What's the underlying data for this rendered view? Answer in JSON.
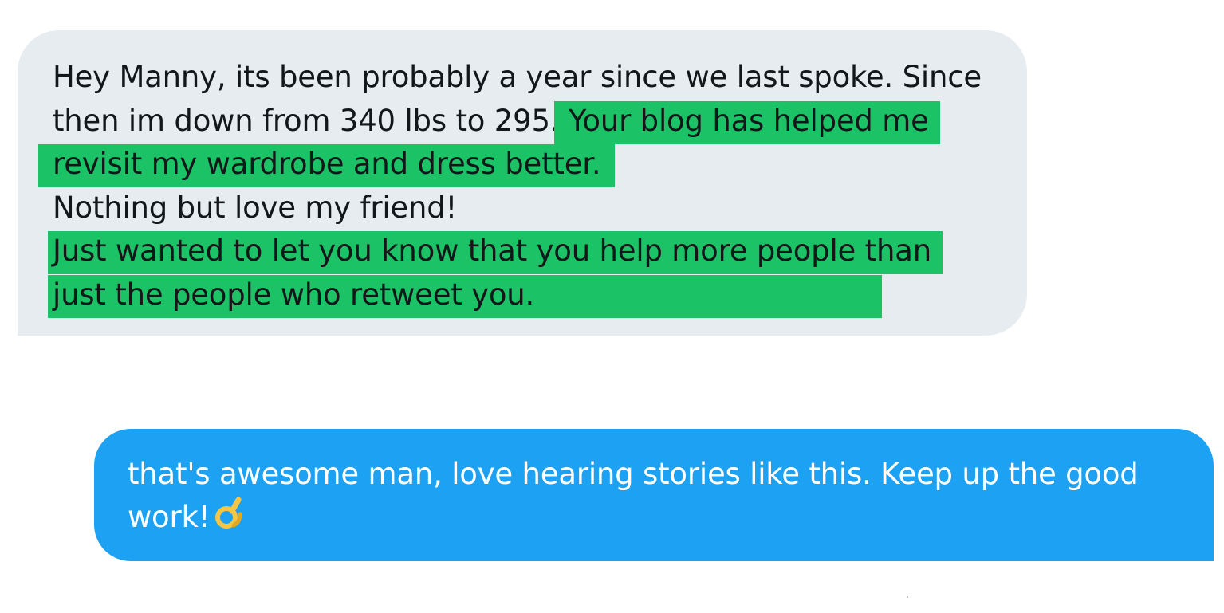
{
  "incoming_message": {
    "lines": [
      [
        {
          "text": "Hey Manny, its been probably a year since we last spoke. Since",
          "highlight": false
        }
      ],
      [
        {
          "text": "then im down from 340 lbs to 295.",
          "highlight": false
        },
        {
          "text": " Your blog has helped me",
          "highlight": true
        }
      ],
      [
        {
          "text": "revisit my wardrobe and dress better.",
          "highlight": true
        }
      ],
      [
        {
          "text": "Nothing but love my friend!",
          "highlight": false
        }
      ],
      [
        {
          "text": "Just wanted to let you know that you help more people than",
          "highlight": true
        }
      ],
      [
        {
          "text": "just the people who retweet you.",
          "highlight": true
        }
      ]
    ]
  },
  "outgoing_message": {
    "line1": "that's awesome man, love hearing stories like this. Keep up the good",
    "line2": "work!",
    "emoji": "ok-hand-icon"
  },
  "colors": {
    "incoming_bubble": "#e6ecf0",
    "outgoing_bubble": "#1da1f2",
    "highlight": "#1cc266"
  }
}
